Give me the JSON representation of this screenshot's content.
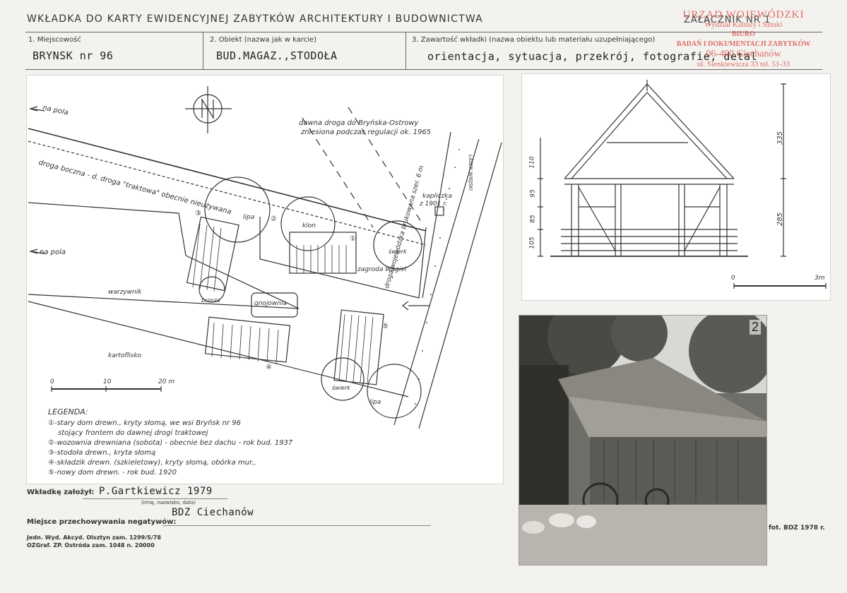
{
  "header": {
    "title": "WKŁADKA DO KARTY EWIDENCYJNEJ ZABYTKÓW ARCHITEKTURY I BUDOWNICTWA",
    "attachment": "ZAŁĄCZNIK NR 1"
  },
  "fields": {
    "f1_label": "1. Miejscowość",
    "f1_value": "BRYNSK nr 96",
    "f2_label": "2. Obiekt (nazwa jak w karcie)",
    "f2_value": "BUD.MAGAZ.,STODOŁA",
    "f3_label": "3. Zawartość wkładki (nazwa obiektu lub materiału uzupełniającego)",
    "f3_value": "orientacja, sytuacja, przekrój, fotografie, detal"
  },
  "stamp": {
    "line1": "URZĄD WOJEWÓDZKI",
    "line2": "Wydział Kultury i Sztuki",
    "line3": "BIURO",
    "line4": "BADAŃ I DOKUMENTACJI ZABYTKÓW",
    "line5": "06-400 Ciechanów",
    "line6": "ul. Sienkiewicza 33 tel. 51-33"
  },
  "site_plan": {
    "na_pola_1": "na pola",
    "na_pola_2": "na pola",
    "road_old": "dawna droga do Bryńska-Ostrowy",
    "road_old_2": "zniesiona podczas regulacji ok. 1965",
    "side_road": "droga boczna - d. droga \"traktowa\" obecnie nieużywana",
    "kapliczka": "kapliczka",
    "kapliczka_year": "z 1901 r.",
    "zagroda": "zagroda Wagiel",
    "lipa_1": "lipa",
    "lipa_2": "lipa",
    "klon": "klon",
    "swierk_1": "świerk",
    "swierk_2": "świerk",
    "brzoza": "brzoza",
    "gnojownia": "gnojownia",
    "warzywnik": "warzywnik",
    "kartoflisko": "kartoflisko",
    "droga_woj": "droga wojewódzka brukowana szer. 6 m",
    "las": "LASEK WIEJSKI",
    "num_1": "①",
    "num_2": "②",
    "num_3": "③",
    "num_4": "④",
    "num_5": "⑤",
    "scale_0": "0",
    "scale_10": "10",
    "scale_20": "20 m"
  },
  "legend": {
    "title": "LEGENDA:",
    "items": [
      "①-stary dom drewn., kryty słomą, we wsi Bryńsk nr 96",
      "stojący frontem do dawnej drogi traktowej",
      "②-wozownia drewniana (sobota) - obecnie bez dachu - rok bud. 1937",
      "③-stodoła drewn., kryta słomą",
      "④-składzik drewn. (szkieletowy), kryty słomą, obórka mur.,",
      "⑤-nowy dom drewn. - rok bud. 1920"
    ]
  },
  "section": {
    "dim_335": "335",
    "dim_285": "285",
    "dim_110": "110",
    "dim_95": "95",
    "dim_85": "85",
    "dim_105": "105",
    "scale_0": "0",
    "scale_3m": "3m"
  },
  "photo": {
    "number": "2"
  },
  "footer": {
    "author_label": "Wkładkę założył:",
    "author_value": "P.Gartkiewicz 1979",
    "author_hint": "(imię, nazwisko, data)",
    "storage_label": "Miejsce przechowywania negatywów:",
    "storage_value": "BDZ Ciechanów",
    "print_1": "Jedn. Wyd. Akcyd. Olsztyn zam. 1299/S/78",
    "print_2": "OZGraf. ZP. Ostróda zam. 1048 n. 20000",
    "photo_credit": "fot. BDZ 1978 r."
  }
}
